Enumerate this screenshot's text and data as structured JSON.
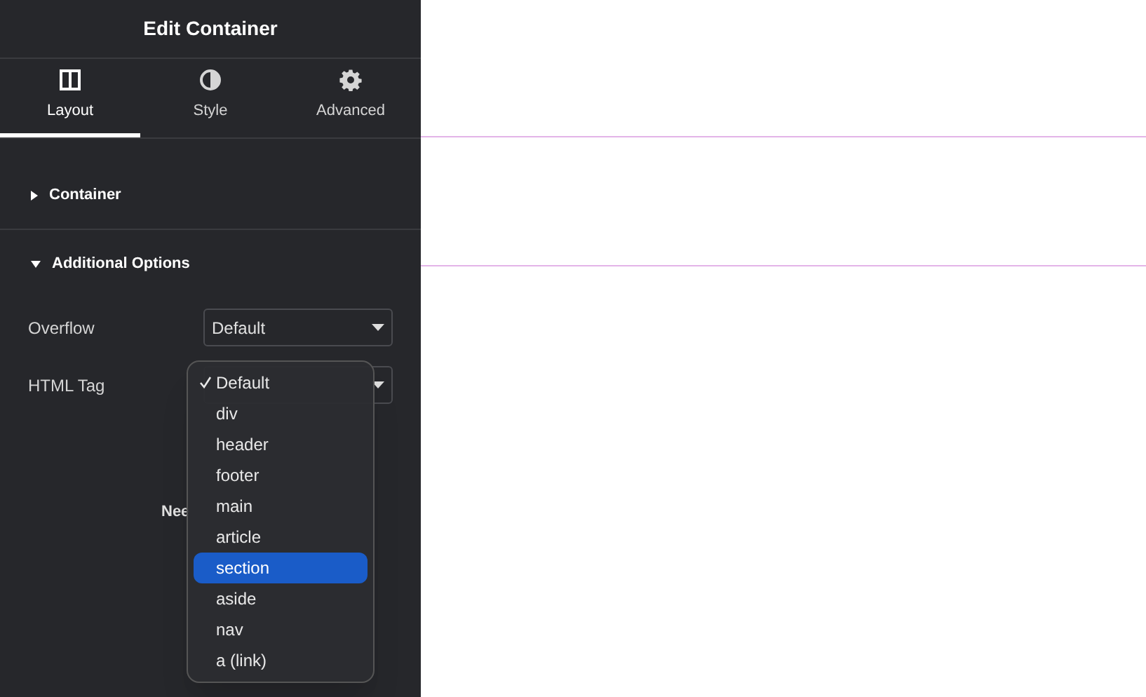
{
  "panel": {
    "title": "Edit Container"
  },
  "tabs": [
    {
      "label": "Layout",
      "selected": true
    },
    {
      "label": "Style",
      "selected": false
    },
    {
      "label": "Advanced",
      "selected": false
    }
  ],
  "sections": [
    {
      "title": "Container",
      "expanded": false
    },
    {
      "title": "Additional Options",
      "expanded": true
    }
  ],
  "fields": [
    {
      "label": "Overflow",
      "value": "Default"
    },
    {
      "label": "HTML Tag"
    }
  ],
  "hidden_text": "Nee",
  "menu": [
    {
      "label": "Default",
      "checked": true,
      "selected": false
    },
    {
      "label": "div",
      "checked": false,
      "selected": false
    },
    {
      "label": "header",
      "checked": false,
      "selected": false
    },
    {
      "label": "footer",
      "checked": false,
      "selected": false
    },
    {
      "label": "main",
      "checked": false,
      "selected": false
    },
    {
      "label": "article",
      "checked": false,
      "selected": false
    },
    {
      "label": "section",
      "checked": false,
      "selected": true
    },
    {
      "label": "aside",
      "checked": false,
      "selected": false
    },
    {
      "label": "nav",
      "checked": false,
      "selected": false
    },
    {
      "label": "a (link)",
      "checked": false,
      "selected": false
    }
  ]
}
